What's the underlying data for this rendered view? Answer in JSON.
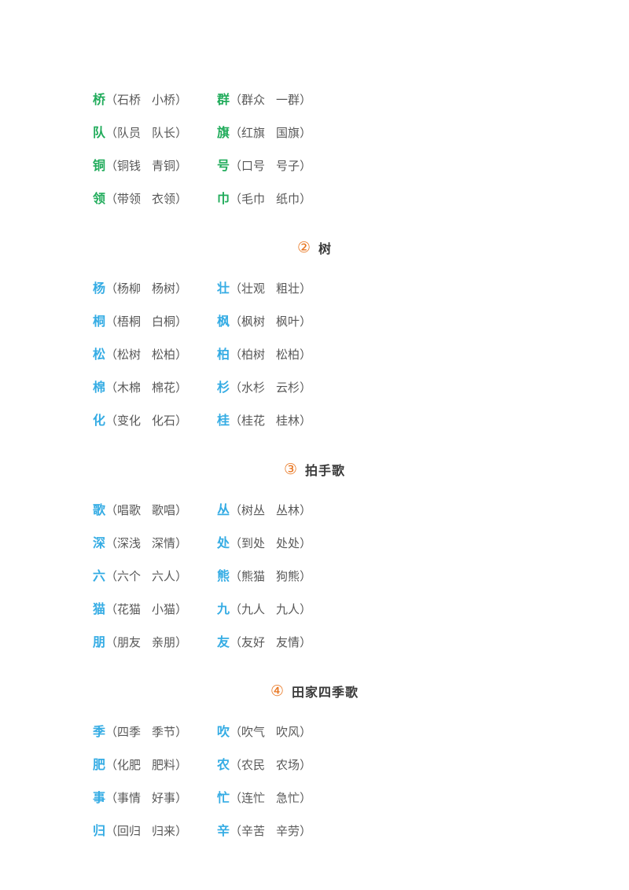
{
  "page": {
    "background_color": "#ffffff",
    "body_text_color": "#585858",
    "accent_orange": "#E8731C",
    "head_green": "#22AC5C",
    "head_blue": "#35ACE4",
    "open_paren": "（",
    "close_paren": "）"
  },
  "sections": [
    {
      "number_glyph": "",
      "title": "",
      "has_header": false,
      "head_color_class": "green",
      "rows": [
        {
          "left": {
            "head": "桥",
            "w1": "石桥",
            "w2": "小桥"
          },
          "right": {
            "head": "群",
            "w1": "群众",
            "w2": "一群"
          }
        },
        {
          "left": {
            "head": "队",
            "w1": "队员",
            "w2": "队长"
          },
          "right": {
            "head": "旗",
            "w1": "红旗",
            "w2": "国旗"
          }
        },
        {
          "left": {
            "head": "铜",
            "w1": "铜钱",
            "w2": "青铜"
          },
          "right": {
            "head": "号",
            "w1": "口号",
            "w2": "号子"
          }
        },
        {
          "left": {
            "head": "领",
            "w1": "带领",
            "w2": "衣领"
          },
          "right": {
            "head": "巾",
            "w1": "毛巾",
            "w2": "纸巾"
          }
        }
      ]
    },
    {
      "number_glyph": "②",
      "title": "树",
      "has_header": true,
      "head_color_class": "blue",
      "rows": [
        {
          "left": {
            "head": "杨",
            "w1": "杨柳",
            "w2": "杨树"
          },
          "right": {
            "head": "壮",
            "w1": "壮观",
            "w2": "粗壮"
          }
        },
        {
          "left": {
            "head": "桐",
            "w1": "梧桐",
            "w2": "白桐"
          },
          "right": {
            "head": "枫",
            "w1": "枫树",
            "w2": "枫叶"
          }
        },
        {
          "left": {
            "head": "松",
            "w1": "松树",
            "w2": "松柏"
          },
          "right": {
            "head": "柏",
            "w1": "柏树",
            "w2": "松柏"
          }
        },
        {
          "left": {
            "head": "棉",
            "w1": "木棉",
            "w2": "棉花"
          },
          "right": {
            "head": "杉",
            "w1": "水杉",
            "w2": "云杉"
          }
        },
        {
          "left": {
            "head": "化",
            "w1": "变化",
            "w2": "化石"
          },
          "right": {
            "head": "桂",
            "w1": "桂花",
            "w2": "桂林"
          }
        }
      ]
    },
    {
      "number_glyph": "③",
      "title": "拍手歌",
      "has_header": true,
      "head_color_class": "blue",
      "rows": [
        {
          "left": {
            "head": "歌",
            "w1": "唱歌",
            "w2": "歌唱"
          },
          "right": {
            "head": "丛",
            "w1": "树丛",
            "w2": "丛林"
          }
        },
        {
          "left": {
            "head": "深",
            "w1": "深浅",
            "w2": "深情"
          },
          "right": {
            "head": "处",
            "w1": "到处",
            "w2": "处处"
          }
        },
        {
          "left": {
            "head": "六",
            "w1": "六个",
            "w2": "六人"
          },
          "right": {
            "head": "熊",
            "w1": "熊猫",
            "w2": "狗熊"
          }
        },
        {
          "left": {
            "head": "猫",
            "w1": "花猫",
            "w2": "小猫"
          },
          "right": {
            "head": "九",
            "w1": "九人",
            "w2": "九人"
          }
        },
        {
          "left": {
            "head": "朋",
            "w1": "朋友",
            "w2": "亲朋"
          },
          "right": {
            "head": "友",
            "w1": "友好",
            "w2": "友情"
          }
        }
      ]
    },
    {
      "number_glyph": "④",
      "title": "田家四季歌",
      "has_header": true,
      "head_color_class": "blue",
      "rows": [
        {
          "left": {
            "head": "季",
            "w1": "四季",
            "w2": "季节"
          },
          "right": {
            "head": "吹",
            "w1": "吹气",
            "w2": "吹风"
          }
        },
        {
          "left": {
            "head": "肥",
            "w1": "化肥",
            "w2": "肥料"
          },
          "right": {
            "head": "农",
            "w1": "农民",
            "w2": "农场"
          }
        },
        {
          "left": {
            "head": "事",
            "w1": "事情",
            "w2": "好事"
          },
          "right": {
            "head": "忙",
            "w1": "连忙",
            "w2": "急忙"
          }
        },
        {
          "left": {
            "head": "归",
            "w1": "回归",
            "w2": "归来"
          },
          "right": {
            "head": "辛",
            "w1": "辛苦",
            "w2": "辛劳"
          }
        }
      ]
    }
  ]
}
